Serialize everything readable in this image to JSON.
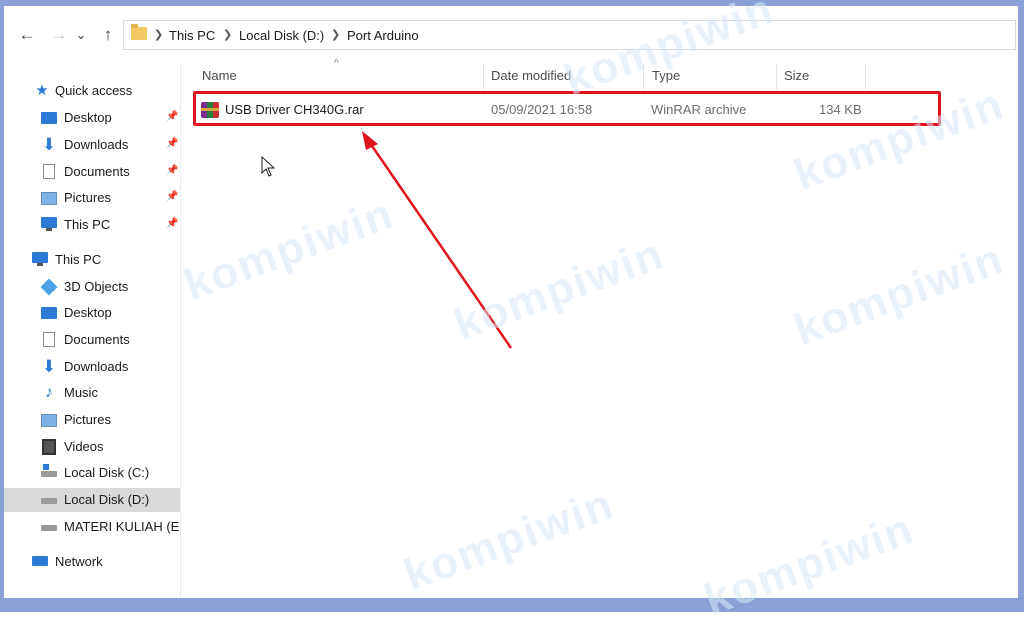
{
  "navigation": {
    "back": "←",
    "forward": "→",
    "recent": "⌄",
    "up": "↑"
  },
  "breadcrumbs": [
    "This PC",
    "Local Disk (D:)",
    "Port Arduino"
  ],
  "sidebar": {
    "quick_access": {
      "label": "Quick access",
      "items": [
        {
          "label": "Desktop",
          "icon": "desktop-icon",
          "pinned": true
        },
        {
          "label": "Downloads",
          "icon": "downloads-icon",
          "pinned": true
        },
        {
          "label": "Documents",
          "icon": "documents-icon",
          "pinned": true
        },
        {
          "label": "Pictures",
          "icon": "pictures-icon",
          "pinned": true
        },
        {
          "label": "This PC",
          "icon": "computer-icon",
          "pinned": true
        }
      ]
    },
    "this_pc": {
      "label": "This PC",
      "items": [
        {
          "label": "3D Objects",
          "icon": "3d-objects-icon"
        },
        {
          "label": "Desktop",
          "icon": "desktop-icon"
        },
        {
          "label": "Documents",
          "icon": "documents-icon"
        },
        {
          "label": "Downloads",
          "icon": "downloads-icon"
        },
        {
          "label": "Music",
          "icon": "music-icon"
        },
        {
          "label": "Pictures",
          "icon": "pictures-icon"
        },
        {
          "label": "Videos",
          "icon": "videos-icon"
        },
        {
          "label": "Local Disk (C:)",
          "icon": "drive-c-icon"
        },
        {
          "label": "Local Disk (D:)",
          "icon": "drive-icon",
          "selected": true
        },
        {
          "label": "MATERI KULIAH (E:)",
          "icon": "drive-icon"
        }
      ]
    },
    "network": {
      "label": "Network",
      "icon": "network-icon"
    }
  },
  "columns": {
    "name": "Name",
    "date_modified": "Date modified",
    "type": "Type",
    "size": "Size"
  },
  "files": [
    {
      "name": "USB Driver CH340G.rar",
      "date_modified": "05/09/2021 16:58",
      "type": "WinRAR archive",
      "size": "134 KB",
      "icon": "winrar-archive-icon"
    }
  ],
  "watermark": "kompiwin",
  "colors": {
    "highlight": "#e0141f",
    "accent": "#2b7bd6",
    "frame": "#8aa1d6"
  }
}
